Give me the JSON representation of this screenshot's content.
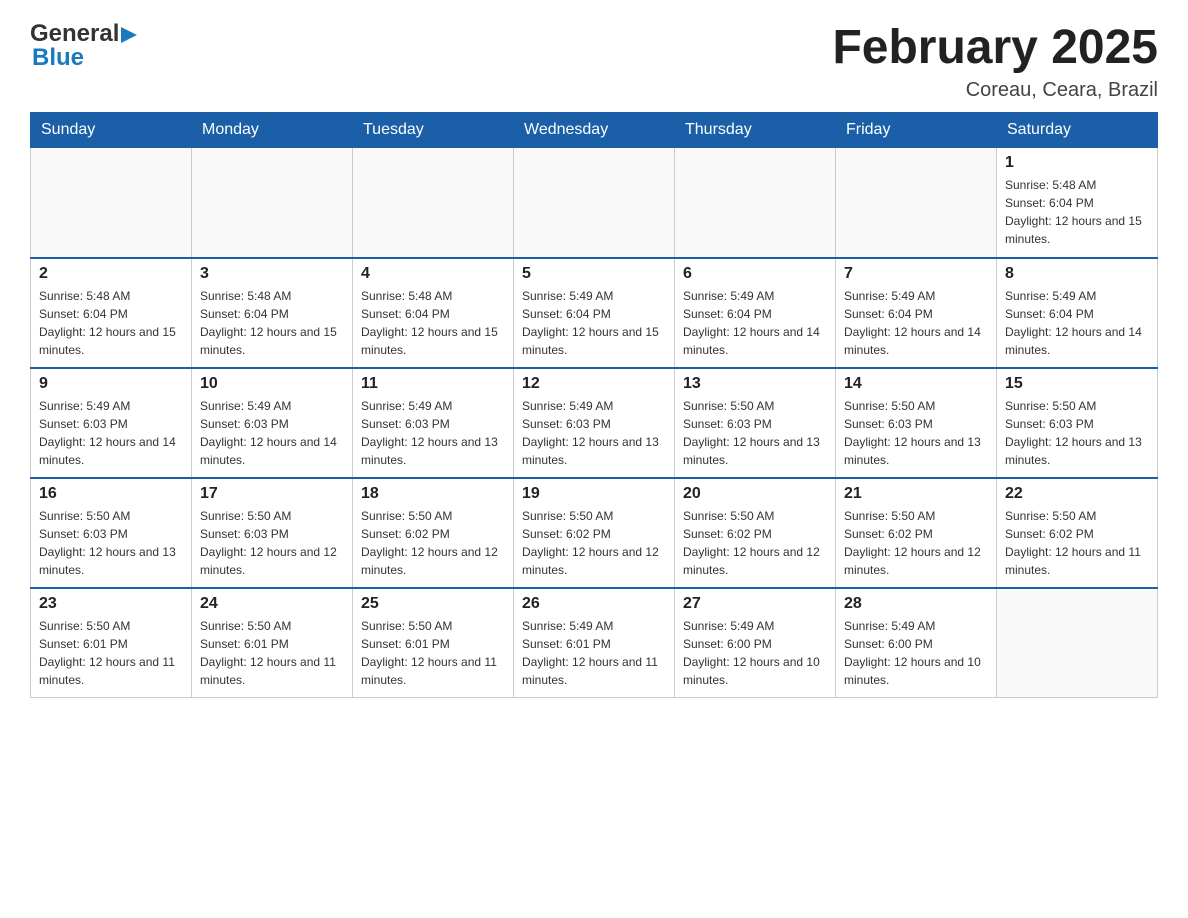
{
  "header": {
    "logo_general": "General",
    "logo_blue": "Blue",
    "title": "February 2025",
    "subtitle": "Coreau, Ceara, Brazil"
  },
  "weekdays": [
    "Sunday",
    "Monday",
    "Tuesday",
    "Wednesday",
    "Thursday",
    "Friday",
    "Saturday"
  ],
  "weeks": [
    [
      {
        "day": "",
        "info": ""
      },
      {
        "day": "",
        "info": ""
      },
      {
        "day": "",
        "info": ""
      },
      {
        "day": "",
        "info": ""
      },
      {
        "day": "",
        "info": ""
      },
      {
        "day": "",
        "info": ""
      },
      {
        "day": "1",
        "info": "Sunrise: 5:48 AM\nSunset: 6:04 PM\nDaylight: 12 hours and 15 minutes."
      }
    ],
    [
      {
        "day": "2",
        "info": "Sunrise: 5:48 AM\nSunset: 6:04 PM\nDaylight: 12 hours and 15 minutes."
      },
      {
        "day": "3",
        "info": "Sunrise: 5:48 AM\nSunset: 6:04 PM\nDaylight: 12 hours and 15 minutes."
      },
      {
        "day": "4",
        "info": "Sunrise: 5:48 AM\nSunset: 6:04 PM\nDaylight: 12 hours and 15 minutes."
      },
      {
        "day": "5",
        "info": "Sunrise: 5:49 AM\nSunset: 6:04 PM\nDaylight: 12 hours and 15 minutes."
      },
      {
        "day": "6",
        "info": "Sunrise: 5:49 AM\nSunset: 6:04 PM\nDaylight: 12 hours and 14 minutes."
      },
      {
        "day": "7",
        "info": "Sunrise: 5:49 AM\nSunset: 6:04 PM\nDaylight: 12 hours and 14 minutes."
      },
      {
        "day": "8",
        "info": "Sunrise: 5:49 AM\nSunset: 6:04 PM\nDaylight: 12 hours and 14 minutes."
      }
    ],
    [
      {
        "day": "9",
        "info": "Sunrise: 5:49 AM\nSunset: 6:03 PM\nDaylight: 12 hours and 14 minutes."
      },
      {
        "day": "10",
        "info": "Sunrise: 5:49 AM\nSunset: 6:03 PM\nDaylight: 12 hours and 14 minutes."
      },
      {
        "day": "11",
        "info": "Sunrise: 5:49 AM\nSunset: 6:03 PM\nDaylight: 12 hours and 13 minutes."
      },
      {
        "day": "12",
        "info": "Sunrise: 5:49 AM\nSunset: 6:03 PM\nDaylight: 12 hours and 13 minutes."
      },
      {
        "day": "13",
        "info": "Sunrise: 5:50 AM\nSunset: 6:03 PM\nDaylight: 12 hours and 13 minutes."
      },
      {
        "day": "14",
        "info": "Sunrise: 5:50 AM\nSunset: 6:03 PM\nDaylight: 12 hours and 13 minutes."
      },
      {
        "day": "15",
        "info": "Sunrise: 5:50 AM\nSunset: 6:03 PM\nDaylight: 12 hours and 13 minutes."
      }
    ],
    [
      {
        "day": "16",
        "info": "Sunrise: 5:50 AM\nSunset: 6:03 PM\nDaylight: 12 hours and 13 minutes."
      },
      {
        "day": "17",
        "info": "Sunrise: 5:50 AM\nSunset: 6:03 PM\nDaylight: 12 hours and 12 minutes."
      },
      {
        "day": "18",
        "info": "Sunrise: 5:50 AM\nSunset: 6:02 PM\nDaylight: 12 hours and 12 minutes."
      },
      {
        "day": "19",
        "info": "Sunrise: 5:50 AM\nSunset: 6:02 PM\nDaylight: 12 hours and 12 minutes."
      },
      {
        "day": "20",
        "info": "Sunrise: 5:50 AM\nSunset: 6:02 PM\nDaylight: 12 hours and 12 minutes."
      },
      {
        "day": "21",
        "info": "Sunrise: 5:50 AM\nSunset: 6:02 PM\nDaylight: 12 hours and 12 minutes."
      },
      {
        "day": "22",
        "info": "Sunrise: 5:50 AM\nSunset: 6:02 PM\nDaylight: 12 hours and 11 minutes."
      }
    ],
    [
      {
        "day": "23",
        "info": "Sunrise: 5:50 AM\nSunset: 6:01 PM\nDaylight: 12 hours and 11 minutes."
      },
      {
        "day": "24",
        "info": "Sunrise: 5:50 AM\nSunset: 6:01 PM\nDaylight: 12 hours and 11 minutes."
      },
      {
        "day": "25",
        "info": "Sunrise: 5:50 AM\nSunset: 6:01 PM\nDaylight: 12 hours and 11 minutes."
      },
      {
        "day": "26",
        "info": "Sunrise: 5:49 AM\nSunset: 6:01 PM\nDaylight: 12 hours and 11 minutes."
      },
      {
        "day": "27",
        "info": "Sunrise: 5:49 AM\nSunset: 6:00 PM\nDaylight: 12 hours and 10 minutes."
      },
      {
        "day": "28",
        "info": "Sunrise: 5:49 AM\nSunset: 6:00 PM\nDaylight: 12 hours and 10 minutes."
      },
      {
        "day": "",
        "info": ""
      }
    ]
  ]
}
